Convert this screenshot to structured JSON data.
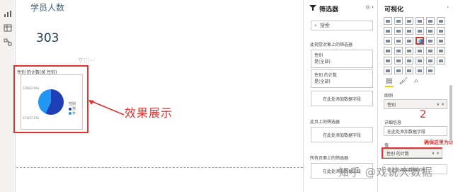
{
  "canvas": {
    "card_title": "学员人数",
    "card_value": "303",
    "annotation": "效果展示",
    "visual": {
      "title": "性别 的计数(按 性别)",
      "legend_title": "性别",
      "legend": [
        {
          "label": "男",
          "color": "#1f3fb8"
        },
        {
          "label": "女",
          "color": "#2196f3"
        }
      ],
      "slice_labels": [
        "173(57.1%)",
        "130(42.9%)"
      ]
    },
    "chart_data": {
      "type": "pie",
      "title": "性别 的计数(按 性别)",
      "categories": [
        "男",
        "女"
      ],
      "values": [
        173,
        130
      ],
      "colors": [
        "#1f3fb8",
        "#2196f3"
      ]
    }
  },
  "filters": {
    "title": "筛选器",
    "search_placeholder": "搜索",
    "visual_section": "此视觉对象上的筛选器",
    "filter1_name": "性别",
    "filter1_value": "是(全部)",
    "filter2_name": "性别 的计数",
    "filter2_value": "是(全部)",
    "add_field": "在此处添加数据字段",
    "page_section": "此页上的筛选器",
    "all_section": "所有页面上的筛选器"
  },
  "viz_pane": {
    "title": "可视化",
    "legend_label": "图例",
    "legend_field": "性别",
    "detail_label": "详细信息",
    "detail_placeholder": "在此处添加数据字段",
    "values_label": "值",
    "values_field": "性别 的计数",
    "values_placeholder": "在此处添加数据字段",
    "step_number": "2",
    "note": "确保这里为计",
    "tabs": [
      "field-tab",
      "format-tab",
      "analytics-tab"
    ]
  },
  "watermark": "知乎 @戏说大数据"
}
